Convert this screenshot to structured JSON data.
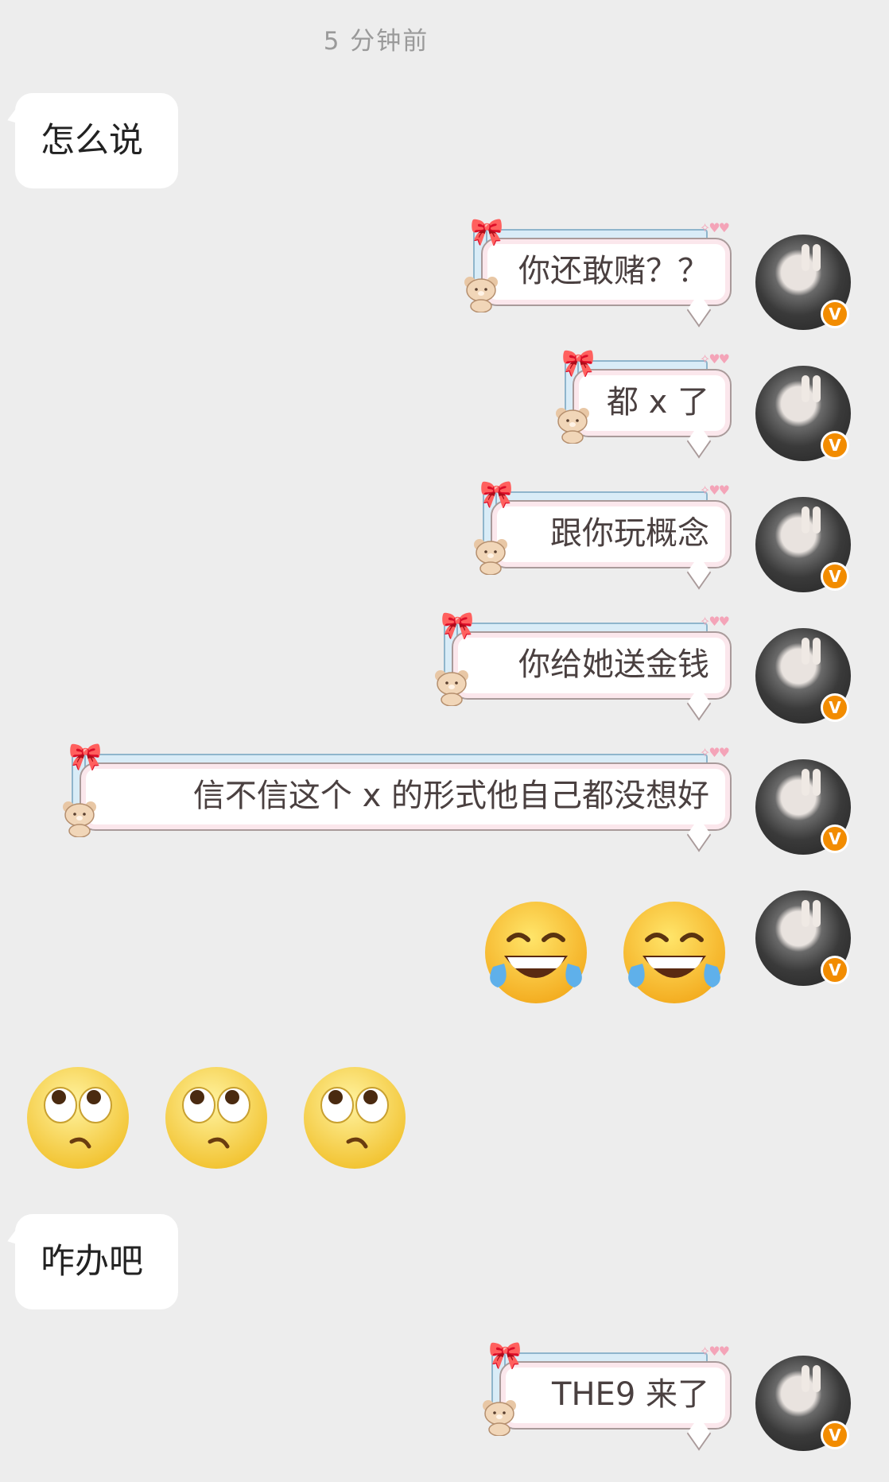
{
  "timestamp": "5 分钟前",
  "incoming": [
    {
      "text": "怎么说"
    },
    {
      "text": "咋办吧"
    }
  ],
  "outgoing": [
    {
      "text": "你还敢赌？？"
    },
    {
      "text": "都 x 了"
    },
    {
      "text": "跟你玩概念"
    },
    {
      "text": "你给她送金钱"
    },
    {
      "text": "信不信这个 x 的形式他自己都没想好"
    },
    {
      "text": "THE9 来了"
    }
  ],
  "emoji_rows": {
    "outgoing": [
      "tears-of-joy-emoji",
      "tears-of-joy-emoji"
    ],
    "incoming": [
      "eye-roll-emoji",
      "eye-roll-emoji",
      "eye-roll-emoji"
    ]
  },
  "avatar_badge": "V",
  "colors": {
    "background": "#ededed",
    "bubble": "#ffffff",
    "badge": "#f28c00"
  }
}
